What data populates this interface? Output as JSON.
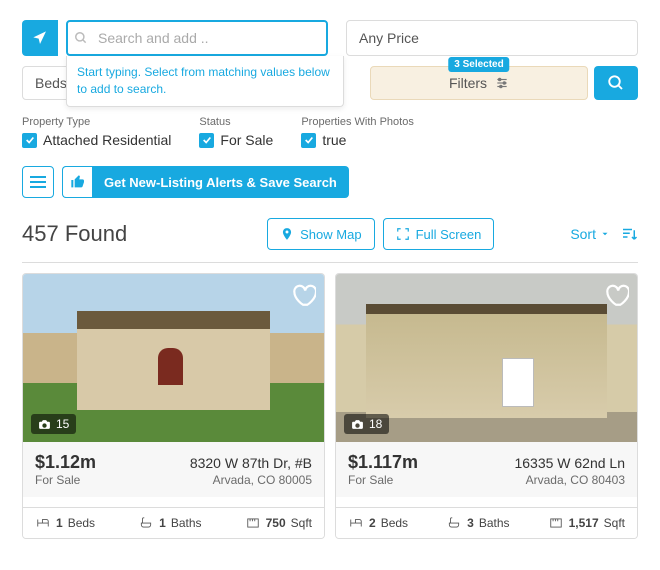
{
  "search": {
    "placeholder": "Search and add ..",
    "hint": "Start typing. Select from matching values below to add to search.",
    "price_label": "Any Price"
  },
  "row2": {
    "beds": "Beds",
    "filters_label": "Filters",
    "filters_badge": "3 Selected"
  },
  "active": {
    "pt_label": "Property Type",
    "pt_value": "Attached Residential",
    "status_label": "Status",
    "status_value": "For Sale",
    "photos_label": "Properties With Photos",
    "photos_value": "true"
  },
  "alerts": {
    "text": "Get New-Listing Alerts & Save Search"
  },
  "results": {
    "found": "457 Found",
    "show_map": "Show Map",
    "full_screen": "Full Screen",
    "sort": "Sort"
  },
  "listings": [
    {
      "photo_count": "15",
      "price": "$1.12m",
      "status": "For Sale",
      "addr1": "8320 W 87th Dr, #B",
      "addr2": "Arvada, CO 80005",
      "beds_n": "1",
      "beds_l": "Beds",
      "baths_n": "1",
      "baths_l": "Baths",
      "sqft_n": "750",
      "sqft_l": "Sqft"
    },
    {
      "photo_count": "18",
      "price": "$1.117m",
      "status": "For Sale",
      "addr1": "16335 W 62nd Ln",
      "addr2": "Arvada, CO 80403",
      "beds_n": "2",
      "beds_l": "Beds",
      "baths_n": "3",
      "baths_l": "Baths",
      "sqft_n": "1,517",
      "sqft_l": "Sqft"
    }
  ]
}
